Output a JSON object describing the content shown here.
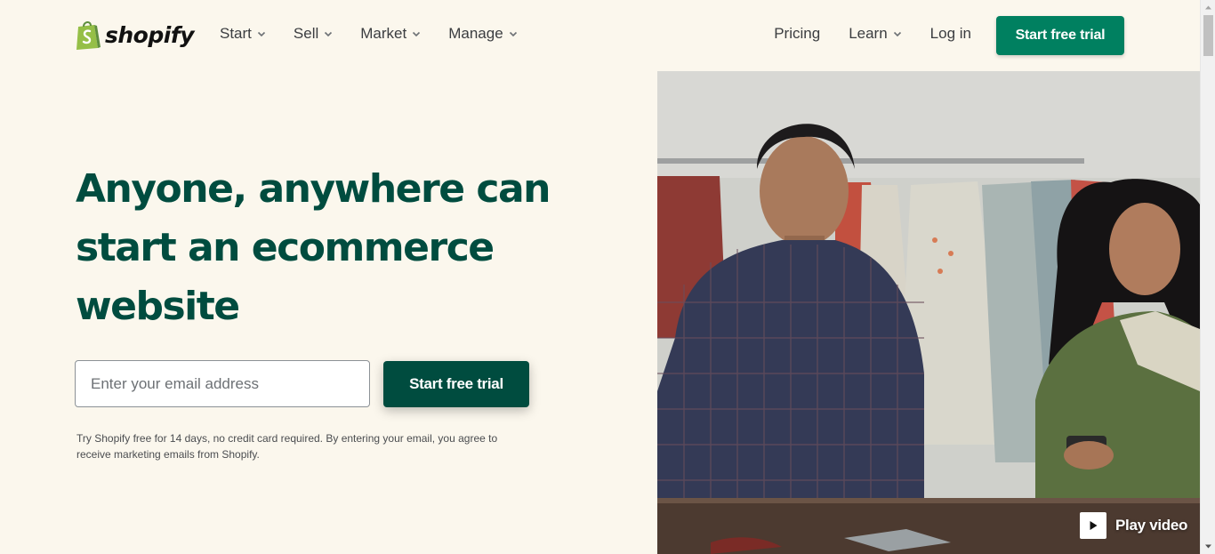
{
  "brand": {
    "name": "shopify",
    "accent": "#008060",
    "dark": "#004c3f"
  },
  "nav": {
    "left": [
      {
        "label": "Start"
      },
      {
        "label": "Sell"
      },
      {
        "label": "Market"
      },
      {
        "label": "Manage"
      }
    ],
    "pricing": "Pricing",
    "learn": "Learn",
    "login": "Log in",
    "cta": "Start free trial"
  },
  "hero": {
    "headline_line1": "Anyone, anywhere can",
    "headline_line2": "start an ecommerce",
    "headline_line3": "website",
    "email_placeholder": "Enter your email address",
    "cta": "Start free trial",
    "disclaimer_line1": "Try Shopify free for 14 days, no credit card required. By entering your email, you agree to",
    "disclaimer_line2": "receive marketing emails from Shopify."
  },
  "media": {
    "play_label": "Play video",
    "icon": "play-icon"
  }
}
